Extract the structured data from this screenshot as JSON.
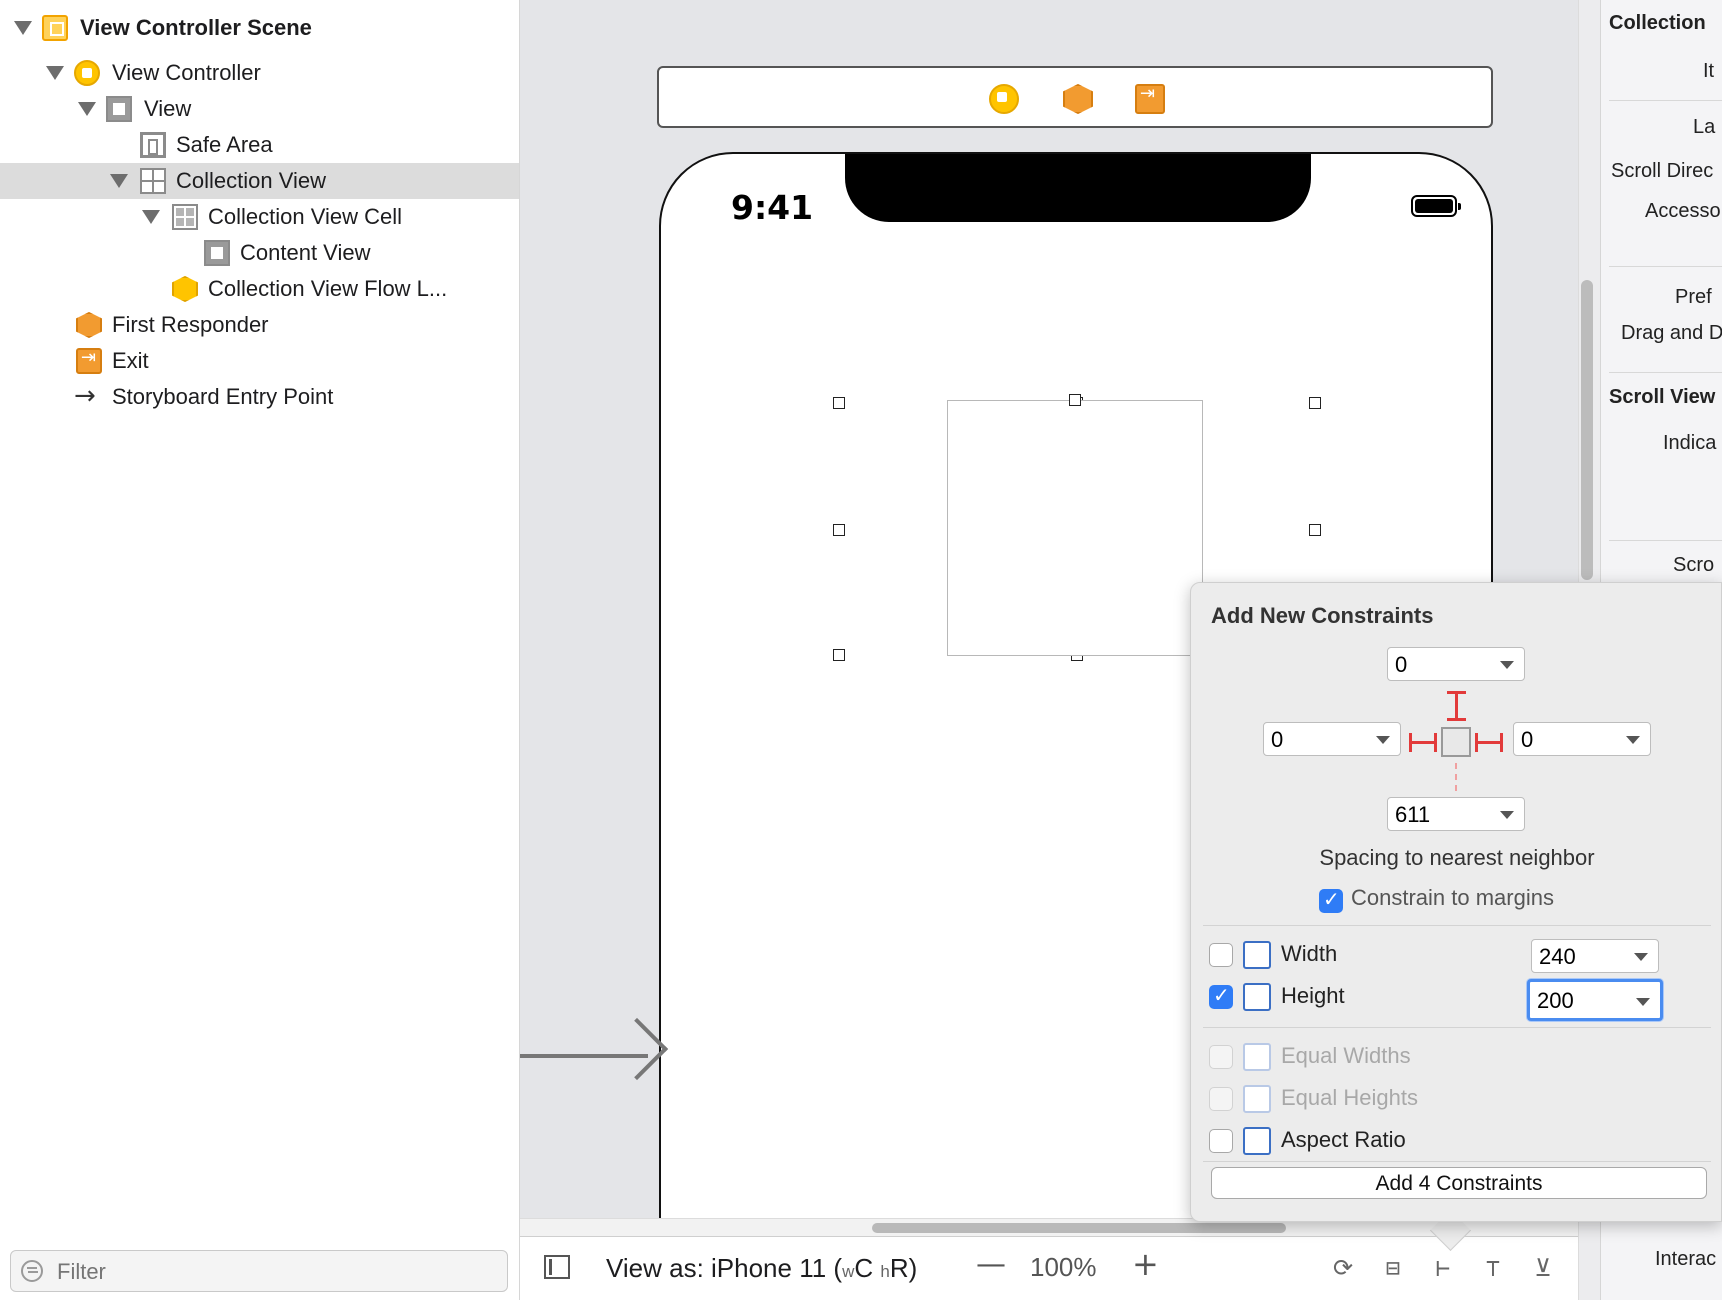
{
  "navigator": {
    "items": [
      {
        "label": "View Controller Scene",
        "icon": "scene-icon"
      },
      {
        "label": "View Controller",
        "icon": "view-controller-icon"
      },
      {
        "label": "View",
        "icon": "view-icon"
      },
      {
        "label": "Safe Area",
        "icon": "safe-area-icon"
      },
      {
        "label": "Collection View",
        "icon": "collection-view-icon",
        "selected": true
      },
      {
        "label": "Collection View Cell",
        "icon": "collection-view-cell-icon"
      },
      {
        "label": "Content View",
        "icon": "content-view-icon"
      },
      {
        "label": "Collection View Flow L...",
        "icon": "flow-layout-icon"
      },
      {
        "label": "First Responder",
        "icon": "first-responder-icon"
      },
      {
        "label": "Exit",
        "icon": "exit-icon"
      },
      {
        "label": "Storyboard Entry Point",
        "icon": "arrow-right-icon"
      }
    ],
    "filter_placeholder": "Filter"
  },
  "canvas": {
    "status_time": "9:41",
    "view_as_prefix": "View as: iPhone 11 (",
    "size_w": "w",
    "size_c": "C",
    "size_h": "h",
    "size_r": "R)",
    "zoom_level": "100%",
    "zoom_out_symbol": "—",
    "zoom_in_symbol": "+"
  },
  "inspector": {
    "texts": [
      "Collection",
      "It",
      "La",
      "Scroll Direc",
      "Accesso",
      "Pref",
      "Drag and D",
      "Scroll View",
      "Indica",
      "Scro",
      "Interac"
    ]
  },
  "popover": {
    "title": "Add New Constraints",
    "top_value": "0",
    "left_value": "0",
    "right_value": "0",
    "bottom_value": "611",
    "spacing_label": "Spacing to nearest neighbor",
    "constrain_margins_label": "Constrain to margins",
    "constrain_margins_checked": true,
    "width_label": "Width",
    "width_value": "240",
    "width_checked": false,
    "height_label": "Height",
    "height_value": "200",
    "height_checked": true,
    "equal_widths_label": "Equal Widths",
    "equal_heights_label": "Equal Heights",
    "aspect_ratio_label": "Aspect Ratio",
    "add_button_label": "Add 4 Constraints"
  },
  "colors": {
    "accent": "#2f7cf6",
    "constraint_red": "#e23a3a",
    "scene_yellow": "#ffc400",
    "responder_orange": "#f29b30"
  }
}
